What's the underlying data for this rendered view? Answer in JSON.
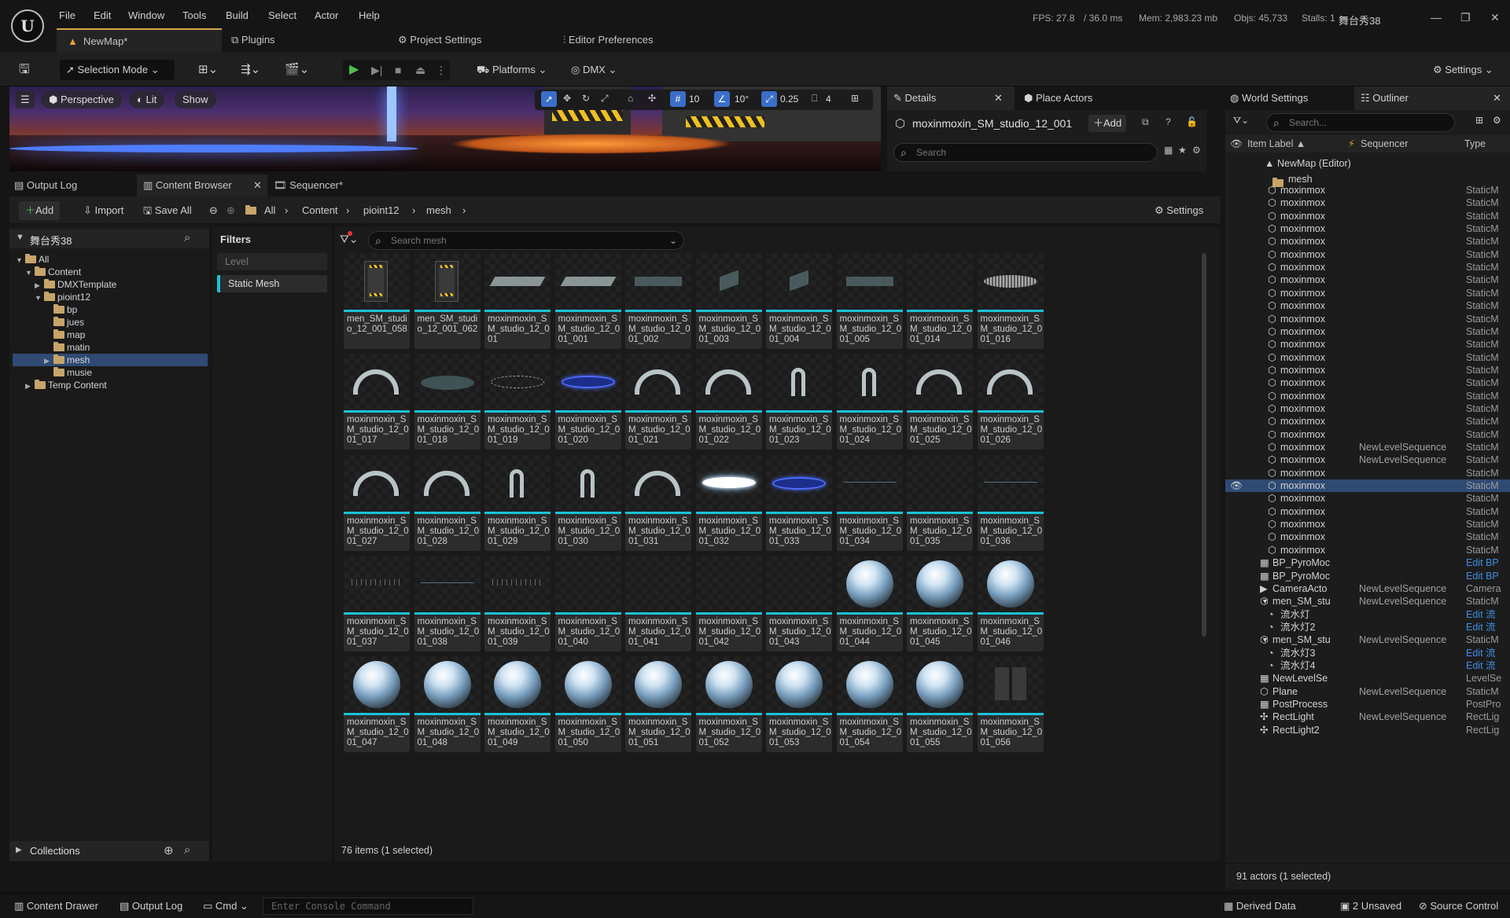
{
  "app": {
    "logo": "U",
    "window_title": "舞台秀38"
  },
  "menu": [
    "File",
    "Edit",
    "Window",
    "Tools",
    "Build",
    "Select",
    "Actor",
    "Help"
  ],
  "stats": {
    "fps": "FPS: 27.8",
    "ms": "/ 36.0 ms",
    "mem": "Mem: 2,983.23 mb",
    "objs": "Objs: 45,733",
    "stalls": "Stalls: 1"
  },
  "doc_tabs": {
    "map": "NewMap*",
    "plugins": "Plugins",
    "project_settings": "Project Settings",
    "editor_prefs": "Editor Preferences"
  },
  "toolbar": {
    "selection_mode": "Selection Mode",
    "platforms": "Platforms",
    "dmx": "DMX",
    "settings": "Settings"
  },
  "viewport": {
    "perspective": "Perspective",
    "lit": "Lit",
    "show": "Show",
    "grid": "10",
    "angle": "10°",
    "scale": "0.25",
    "camera_speed": "4"
  },
  "details": {
    "tab": "Details",
    "place_actors_tab": "Place Actors",
    "object_name": "moxinmoxin_SM_studio_12_001",
    "add": "Add",
    "search_placeholder": "Search"
  },
  "outliner": {
    "world_settings_tab": "World Settings",
    "tab": "Outliner",
    "search_placeholder": "Search...",
    "col_label": "Item Label ▲",
    "col_seq": "Sequencer",
    "col_type": "Type",
    "root": "NewMap (Editor)",
    "folder": "mesh",
    "rows": [
      {
        "label": "moxinmox",
        "seq": "",
        "type": "StaticM"
      },
      {
        "label": "moxinmox",
        "seq": "",
        "type": "StaticM"
      },
      {
        "label": "moxinmox",
        "seq": "",
        "type": "StaticM"
      },
      {
        "label": "moxinmox",
        "seq": "",
        "type": "StaticM"
      },
      {
        "label": "moxinmox",
        "seq": "",
        "type": "StaticM"
      },
      {
        "label": "moxinmox",
        "seq": "",
        "type": "StaticM"
      },
      {
        "label": "moxinmox",
        "seq": "",
        "type": "StaticM"
      },
      {
        "label": "moxinmox",
        "seq": "",
        "type": "StaticM"
      },
      {
        "label": "moxinmox",
        "seq": "",
        "type": "StaticM"
      },
      {
        "label": "moxinmox",
        "seq": "",
        "type": "StaticM"
      },
      {
        "label": "moxinmox",
        "seq": "",
        "type": "StaticM"
      },
      {
        "label": "moxinmox",
        "seq": "",
        "type": "StaticM"
      },
      {
        "label": "moxinmox",
        "seq": "",
        "type": "StaticM"
      },
      {
        "label": "moxinmox",
        "seq": "",
        "type": "StaticM"
      },
      {
        "label": "moxinmox",
        "seq": "",
        "type": "StaticM"
      },
      {
        "label": "moxinmox",
        "seq": "",
        "type": "StaticM"
      },
      {
        "label": "moxinmox",
        "seq": "",
        "type": "StaticM"
      },
      {
        "label": "moxinmox",
        "seq": "",
        "type": "StaticM"
      },
      {
        "label": "moxinmox",
        "seq": "",
        "type": "StaticM"
      },
      {
        "label": "moxinmox",
        "seq": "",
        "type": "StaticM"
      },
      {
        "label": "moxinmox",
        "seq": "NewLevelSequence",
        "type": "StaticM"
      },
      {
        "label": "moxinmox",
        "seq": "NewLevelSequence",
        "type": "StaticM"
      },
      {
        "label": "moxinmox",
        "seq": "",
        "type": "StaticM"
      },
      {
        "label": "moxinmox",
        "seq": "",
        "type": "StaticM"
      },
      {
        "label": "moxinmox",
        "seq": "",
        "type": "StaticM"
      },
      {
        "label": "moxinmox",
        "seq": "",
        "type": "StaticM"
      },
      {
        "label": "moxinmox",
        "seq": "",
        "type": "StaticM"
      },
      {
        "label": "moxinmox",
        "seq": "",
        "type": "StaticM"
      },
      {
        "label": "moxinmox",
        "seq": "",
        "type": "StaticM"
      }
    ],
    "rows2": [
      {
        "label": "BP_PyroMoc",
        "seq": "",
        "type": "Edit BP"
      },
      {
        "label": "BP_PyroMoc",
        "seq": "",
        "type": "Edit BP"
      },
      {
        "label": "CameraActo",
        "seq": "NewLevelSequence",
        "type": "Camera"
      },
      {
        "label": "men_SM_stu",
        "seq": "NewLevelSequence",
        "type": "StaticM"
      },
      {
        "label": "流水灯",
        "seq": "",
        "type": "Edit 流"
      },
      {
        "label": "流水灯2",
        "seq": "",
        "type": "Edit 流"
      },
      {
        "label": "men_SM_stu",
        "seq": "NewLevelSequence",
        "type": "StaticM"
      },
      {
        "label": "流水灯3",
        "seq": "",
        "type": "Edit 流"
      },
      {
        "label": "流水灯4",
        "seq": "",
        "type": "Edit 流"
      },
      {
        "label": "NewLevelSe",
        "seq": "",
        "type": "LevelSe"
      },
      {
        "label": "Plane",
        "seq": "NewLevelSequence",
        "type": "StaticM"
      },
      {
        "label": "PostProcess",
        "seq": "",
        "type": "PostPro"
      },
      {
        "label": "RectLight",
        "seq": "NewLevelSequence",
        "type": "RectLig"
      },
      {
        "label": "RectLight2",
        "seq": "",
        "type": "RectLig"
      }
    ],
    "footer": "91 actors (1 selected)"
  },
  "bottom_tabs": {
    "output_log": "Output Log",
    "content_browser": "Content Browser",
    "sequencer": "Sequencer*"
  },
  "content_browser": {
    "add": "Add",
    "import": "Import",
    "save_all": "Save All",
    "breadcrumb": [
      "All",
      "Content",
      "pioint12",
      "mesh"
    ],
    "settings": "Settings",
    "search_placeholder": "Search mesh",
    "filters_title": "Filters",
    "filters": [
      "Level",
      "Static Mesh"
    ],
    "status": "76 items (1 selected)",
    "collections": "Collections"
  },
  "tree": {
    "project": "舞台秀38",
    "nodes": [
      {
        "label": "All",
        "depth": 0
      },
      {
        "label": "Content",
        "depth": 1
      },
      {
        "label": "DMXTemplate",
        "depth": 2
      },
      {
        "label": "pioint12",
        "depth": 2
      },
      {
        "label": "bp",
        "depth": 3
      },
      {
        "label": "jues",
        "depth": 3
      },
      {
        "label": "map",
        "depth": 3
      },
      {
        "label": "matin",
        "depth": 3
      },
      {
        "label": "mesh",
        "depth": 3
      },
      {
        "label": "musie",
        "depth": 3
      },
      {
        "label": "Temp Content",
        "depth": 1
      }
    ]
  },
  "assets": [
    {
      "name": "men_SM_studio_12_001_058",
      "kind": "door"
    },
    {
      "name": "men_SM_studio_12_001_062",
      "kind": "door"
    },
    {
      "name": "moxinmoxin_SM_studio_12_001",
      "kind": "slab"
    },
    {
      "name": "moxinmoxin_SM_studio_12_001_001",
      "kind": "slab"
    },
    {
      "name": "moxinmoxin_SM_studio_12_001_002",
      "kind": "plank"
    },
    {
      "name": "moxinmoxin_SM_studio_12_001_003",
      "kind": "tile"
    },
    {
      "name": "moxinmoxin_SM_studio_12_001_004",
      "kind": "tile"
    },
    {
      "name": "moxinmoxin_SM_studio_12_001_005",
      "kind": "plank"
    },
    {
      "name": "moxinmoxin_SM_studio_12_001_014",
      "kind": "empty"
    },
    {
      "name": "moxinmoxin_SM_studio_12_001_016",
      "kind": "grill"
    },
    {
      "name": "moxinmoxin_SM_studio_12_001_017",
      "kind": "arch"
    },
    {
      "name": "moxinmoxin_SM_studio_12_001_018",
      "kind": "disc"
    },
    {
      "name": "moxinmoxin_SM_studio_12_001_019",
      "kind": "ring"
    },
    {
      "name": "moxinmoxin_SM_studio_12_001_020",
      "kind": "bluedisc"
    },
    {
      "name": "moxinmoxin_SM_studio_12_001_021",
      "kind": "arch"
    },
    {
      "name": "moxinmoxin_SM_studio_12_001_022",
      "kind": "arch"
    },
    {
      "name": "moxinmoxin_SM_studio_12_001_023",
      "kind": "smallarch"
    },
    {
      "name": "moxinmoxin_SM_studio_12_001_024",
      "kind": "smallarch"
    },
    {
      "name": "moxinmoxin_SM_studio_12_001_025",
      "kind": "arch"
    },
    {
      "name": "moxinmoxin_SM_studio_12_001_026",
      "kind": "arch"
    },
    {
      "name": "moxinmoxin_SM_studio_12_001_027",
      "kind": "arch"
    },
    {
      "name": "moxinmoxin_SM_studio_12_001_028",
      "kind": "arch"
    },
    {
      "name": "moxinmoxin_SM_studio_12_001_029",
      "kind": "smallarch"
    },
    {
      "name": "moxinmoxin_SM_studio_12_001_030",
      "kind": "smallarch"
    },
    {
      "name": "moxinmoxin_SM_studio_12_001_031",
      "kind": "arch"
    },
    {
      "name": "moxinmoxin_SM_studio_12_001_032",
      "kind": "glowdisc"
    },
    {
      "name": "moxinmoxin_SM_studio_12_001_033",
      "kind": "bluedisc"
    },
    {
      "name": "moxinmoxin_SM_studio_12_001_034",
      "kind": "line"
    },
    {
      "name": "moxinmoxin_SM_studio_12_001_035",
      "kind": "empty"
    },
    {
      "name": "moxinmoxin_SM_studio_12_001_036",
      "kind": "line"
    },
    {
      "name": "moxinmoxin_SM_studio_12_001_037",
      "kind": "dots"
    },
    {
      "name": "moxinmoxin_SM_studio_12_001_038",
      "kind": "line"
    },
    {
      "name": "moxinmoxin_SM_studio_12_001_039",
      "kind": "dots"
    },
    {
      "name": "moxinmoxin_SM_studio_12_001_040",
      "kind": "empty"
    },
    {
      "name": "moxinmoxin_SM_studio_12_001_041",
      "kind": "empty"
    },
    {
      "name": "moxinmoxin_SM_studio_12_001_042",
      "kind": "empty"
    },
    {
      "name": "moxinmoxin_SM_studio_12_001_043",
      "kind": "empty"
    },
    {
      "name": "moxinmoxin_SM_studio_12_001_044",
      "kind": "sphere"
    },
    {
      "name": "moxinmoxin_SM_studio_12_001_045",
      "kind": "sphere"
    },
    {
      "name": "moxinmoxin_SM_studio_12_001_046",
      "kind": "sphere"
    },
    {
      "name": "moxinmoxin_SM_studio_12_001_047",
      "kind": "sphere"
    },
    {
      "name": "moxinmoxin_SM_studio_12_001_048",
      "kind": "sphere"
    },
    {
      "name": "moxinmoxin_SM_studio_12_001_049",
      "kind": "sphere"
    },
    {
      "name": "moxinmoxin_SM_studio_12_001_050",
      "kind": "sphere"
    },
    {
      "name": "moxinmoxin_SM_studio_12_001_051",
      "kind": "sphere"
    },
    {
      "name": "moxinmoxin_SM_studio_12_001_052",
      "kind": "sphere"
    },
    {
      "name": "moxinmoxin_SM_studio_12_001_053",
      "kind": "sphere"
    },
    {
      "name": "moxinmoxin_SM_studio_12_001_054",
      "kind": "sphere"
    },
    {
      "name": "moxinmoxin_SM_studio_12_001_055",
      "kind": "sphere"
    },
    {
      "name": "moxinmoxin_SM_studio_12_001_056",
      "kind": "panels"
    }
  ],
  "statusbar": {
    "content_drawer": "Content Drawer",
    "output_log": "Output Log",
    "cmd": "Cmd",
    "console_placeholder": "Enter Console Command",
    "derived_data": "Derived Data",
    "unsaved": "2 Unsaved",
    "source_control": "Source Control"
  },
  "colors": {
    "accent_cyan": "#19c3d6",
    "selection": "#2f4a73",
    "play_green": "#4cc14a",
    "link_blue": "#3f8fe3"
  }
}
